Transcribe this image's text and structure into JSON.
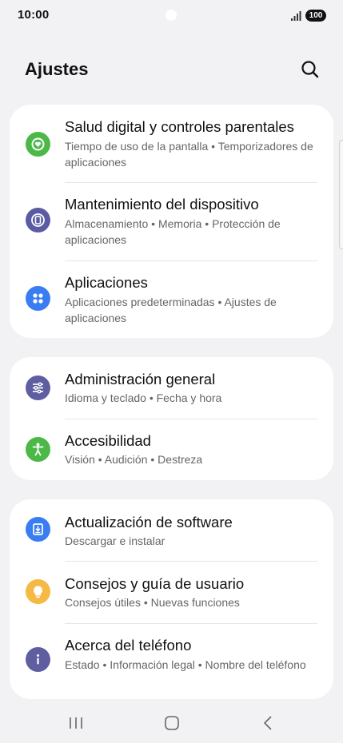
{
  "status": {
    "time": "10:00",
    "battery": "100"
  },
  "header": {
    "title": "Ajustes"
  },
  "groups": [
    {
      "items": [
        {
          "title": "Salud digital y controles parentales",
          "subtitle": "Tiempo de uso de la pantalla  •  Temporizadores de aplicaciones",
          "icon": "digital-wellbeing-icon",
          "color": "#4cb848"
        },
        {
          "title": "Mantenimiento del dispositivo",
          "subtitle": "Almacenamiento  •  Memoria  •  Protección de aplicaciones",
          "icon": "device-care-icon",
          "color": "#5a5ba3"
        },
        {
          "title": "Aplicaciones",
          "subtitle": "Aplicaciones predeterminadas  •  Ajustes de aplicaciones",
          "icon": "apps-icon",
          "color": "#3a7cf2"
        }
      ]
    },
    {
      "items": [
        {
          "title": "Administración general",
          "subtitle": "Idioma y teclado  •  Fecha y hora",
          "icon": "general-management-icon",
          "color": "#5f5ea0"
        },
        {
          "title": "Accesibilidad",
          "subtitle": "Visión  •  Audición  •  Destreza",
          "icon": "accessibility-icon",
          "color": "#4cb848"
        }
      ]
    },
    {
      "items": [
        {
          "title": "Actualización de software",
          "subtitle": "Descargar e instalar",
          "icon": "software-update-icon",
          "color": "#3a7cf2"
        },
        {
          "title": "Consejos y guía de usuario",
          "subtitle": "Consejos útiles  •  Nuevas funciones",
          "icon": "tips-icon",
          "color": "#f5b944"
        },
        {
          "title": "Acerca del teléfono",
          "subtitle": "Estado  •  Información legal  •  Nombre del teléfono",
          "icon": "about-phone-icon",
          "color": "#5f5ea0"
        }
      ]
    }
  ]
}
